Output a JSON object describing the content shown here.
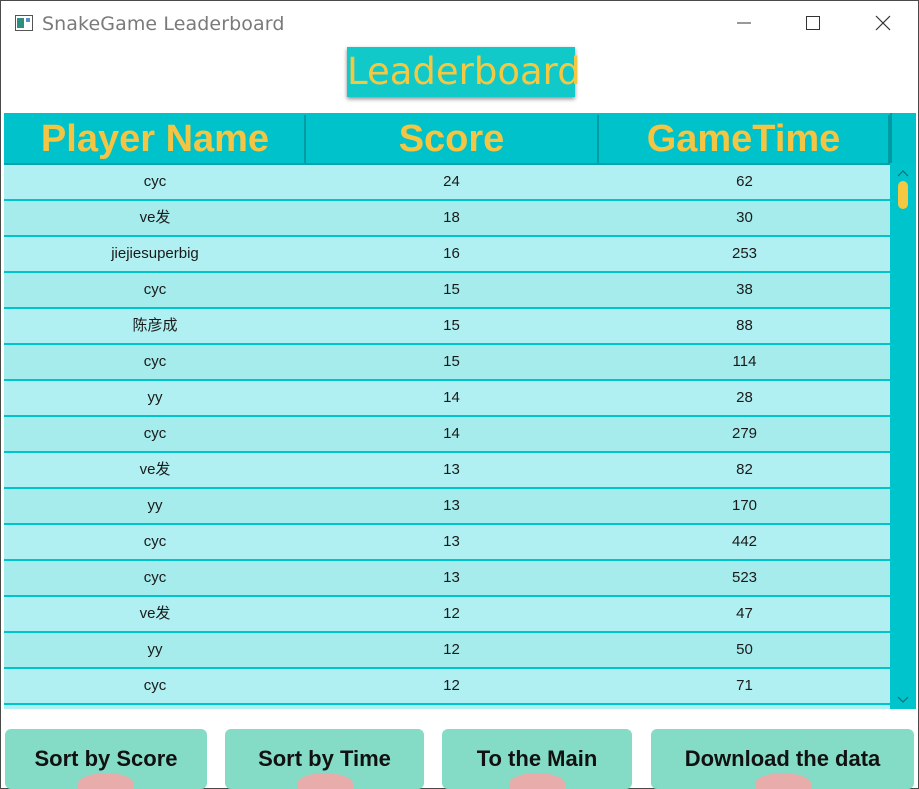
{
  "window": {
    "title": "SnakeGame Leaderboard"
  },
  "heading": "Leaderboard",
  "table": {
    "columns": [
      "Player Name",
      "Score",
      "GameTime"
    ],
    "rows": [
      [
        "cyc",
        "24",
        "62"
      ],
      [
        "ve发",
        "18",
        "30"
      ],
      [
        "jiejiesuperbig",
        "16",
        "253"
      ],
      [
        "cyc",
        "15",
        "38"
      ],
      [
        "陈彦成",
        "15",
        "88"
      ],
      [
        "cyc",
        "15",
        "114"
      ],
      [
        "yy",
        "14",
        "28"
      ],
      [
        "cyc",
        "14",
        "279"
      ],
      [
        "ve发",
        "13",
        "82"
      ],
      [
        "yy",
        "13",
        "170"
      ],
      [
        "cyc",
        "13",
        "442"
      ],
      [
        "cyc",
        "13",
        "523"
      ],
      [
        "ve发",
        "12",
        "47"
      ],
      [
        "yy",
        "12",
        "50"
      ],
      [
        "cyc",
        "12",
        "71"
      ]
    ]
  },
  "buttons": {
    "sort_score": "Sort by Score",
    "sort_time": "Sort by Time",
    "to_main": "To the Main",
    "download": "Download the data"
  },
  "colors": {
    "accent": "#00c4cc",
    "heading_text": "#f5c842",
    "row_light": "#b0f0f2",
    "row_dark": "#a6ecec",
    "button": "#84dcc6"
  }
}
